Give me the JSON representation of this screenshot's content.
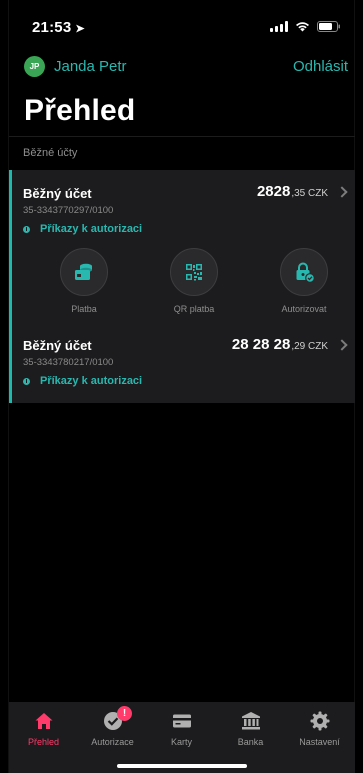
{
  "status_bar": {
    "time": "21:53"
  },
  "user": {
    "initials": "JP",
    "name": "Janda Petr",
    "logout_label": "Odhlásit"
  },
  "page_title": "Přehled",
  "section_title": "Běžné účty",
  "accounts": [
    {
      "name": "Běžný účet",
      "number": "35-3343770297/0100",
      "status": "Příkazy k autorizaci",
      "amount_main": "2828",
      "amount_rest": ",35 CZK"
    },
    {
      "name": "Běžný účet",
      "number": "35-3343780217/0100",
      "status": "Příkazy k autorizaci",
      "amount_main": "28 28 28",
      "amount_rest": ",29 CZK"
    }
  ],
  "actions": [
    {
      "label": "Platba",
      "icon": "payment-icon"
    },
    {
      "label": "QR platba",
      "icon": "qr-code-icon"
    },
    {
      "label": "Autorizovat",
      "icon": "authorize-lock-icon"
    }
  ],
  "tabs": [
    {
      "label": "Přehled",
      "icon": "home-icon",
      "active": true
    },
    {
      "label": "Autorizace",
      "icon": "check-badge-icon",
      "badge": "!"
    },
    {
      "label": "Karty",
      "icon": "card-icon"
    },
    {
      "label": "Banka",
      "icon": "bank-icon"
    },
    {
      "label": "Nastavení",
      "icon": "gear-icon"
    }
  ],
  "colors": {
    "accent": "#29b8b0",
    "active_tab": "#ff3b6b",
    "avatar": "#3aa655",
    "card_bg": "#1c1c1e"
  }
}
